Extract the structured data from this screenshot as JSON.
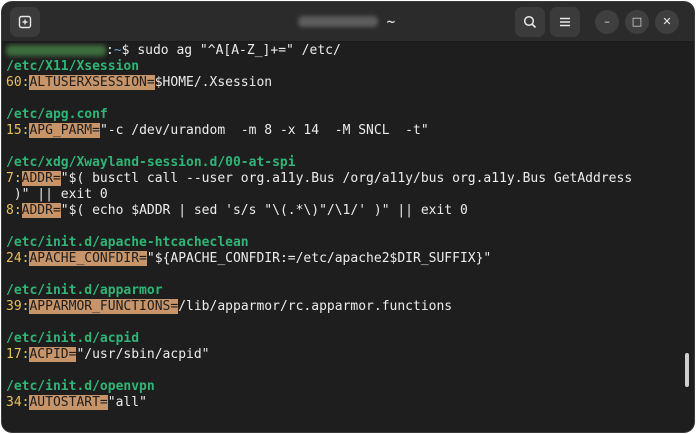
{
  "window": {
    "title_suffix": "~"
  },
  "titlebar": {
    "new_tab_icon": "new-tab-icon",
    "search_icon": "search-icon",
    "menu_icon": "hamburger-menu-icon",
    "minimize_glyph": "–",
    "maximize_glyph": "□",
    "close_glyph": "✕"
  },
  "terminal": {
    "prompt": {
      "path": "~",
      "symbol": "$",
      "command": "sudo ag \"^A[A-Z_]+=\" /etc/"
    },
    "results": [
      {
        "file": "/etc/X11/Xsession",
        "lines": [
          {
            "num": "60",
            "match": "ALTUSERXSESSION=",
            "rest": "$HOME/.Xsession"
          }
        ]
      },
      {
        "file": "/etc/apg.conf",
        "lines": [
          {
            "num": "15",
            "match": "APG_PARM=",
            "rest": "\"-c /dev/urandom  -m 8 -x 14  -M SNCL  -t\""
          }
        ]
      },
      {
        "file": "/etc/xdg/Xwayland-session.d/00-at-spi",
        "lines": [
          {
            "num": "7",
            "match": "ADDR=",
            "rest": "\"$( busctl call --user org.a11y.Bus /org/a11y/bus org.a11y.Bus GetAddress",
            "wrap": " )\" || exit 0"
          },
          {
            "num": "8",
            "match": "ADDR=",
            "rest": "\"$( echo $ADDR | sed 's/s \"\\(.*\\)\"/\\1/' )\" || exit 0"
          }
        ]
      },
      {
        "file": "/etc/init.d/apache-htcacheclean",
        "lines": [
          {
            "num": "24",
            "match": "APACHE_CONFDIR=",
            "rest": "\"${APACHE_CONFDIR:=/etc/apache2$DIR_SUFFIX}\""
          }
        ]
      },
      {
        "file": "/etc/init.d/apparmor",
        "lines": [
          {
            "num": "39",
            "match": "APPARMOR_FUNCTIONS=",
            "rest": "/lib/apparmor/rc.apparmor.functions"
          }
        ]
      },
      {
        "file": "/etc/init.d/acpid",
        "lines": [
          {
            "num": "17",
            "match": "ACPID=",
            "rest": "\"/usr/sbin/acpid\""
          }
        ]
      },
      {
        "file": "/etc/init.d/openvpn",
        "lines": [
          {
            "num": "34",
            "match": "AUTOSTART=",
            "rest": "\"all\""
          }
        ]
      }
    ]
  },
  "colors": {
    "file_heading": "#2fb676",
    "line_number": "#e9c060",
    "match_highlight": "#c8956a",
    "background": "#1e1e1e"
  }
}
